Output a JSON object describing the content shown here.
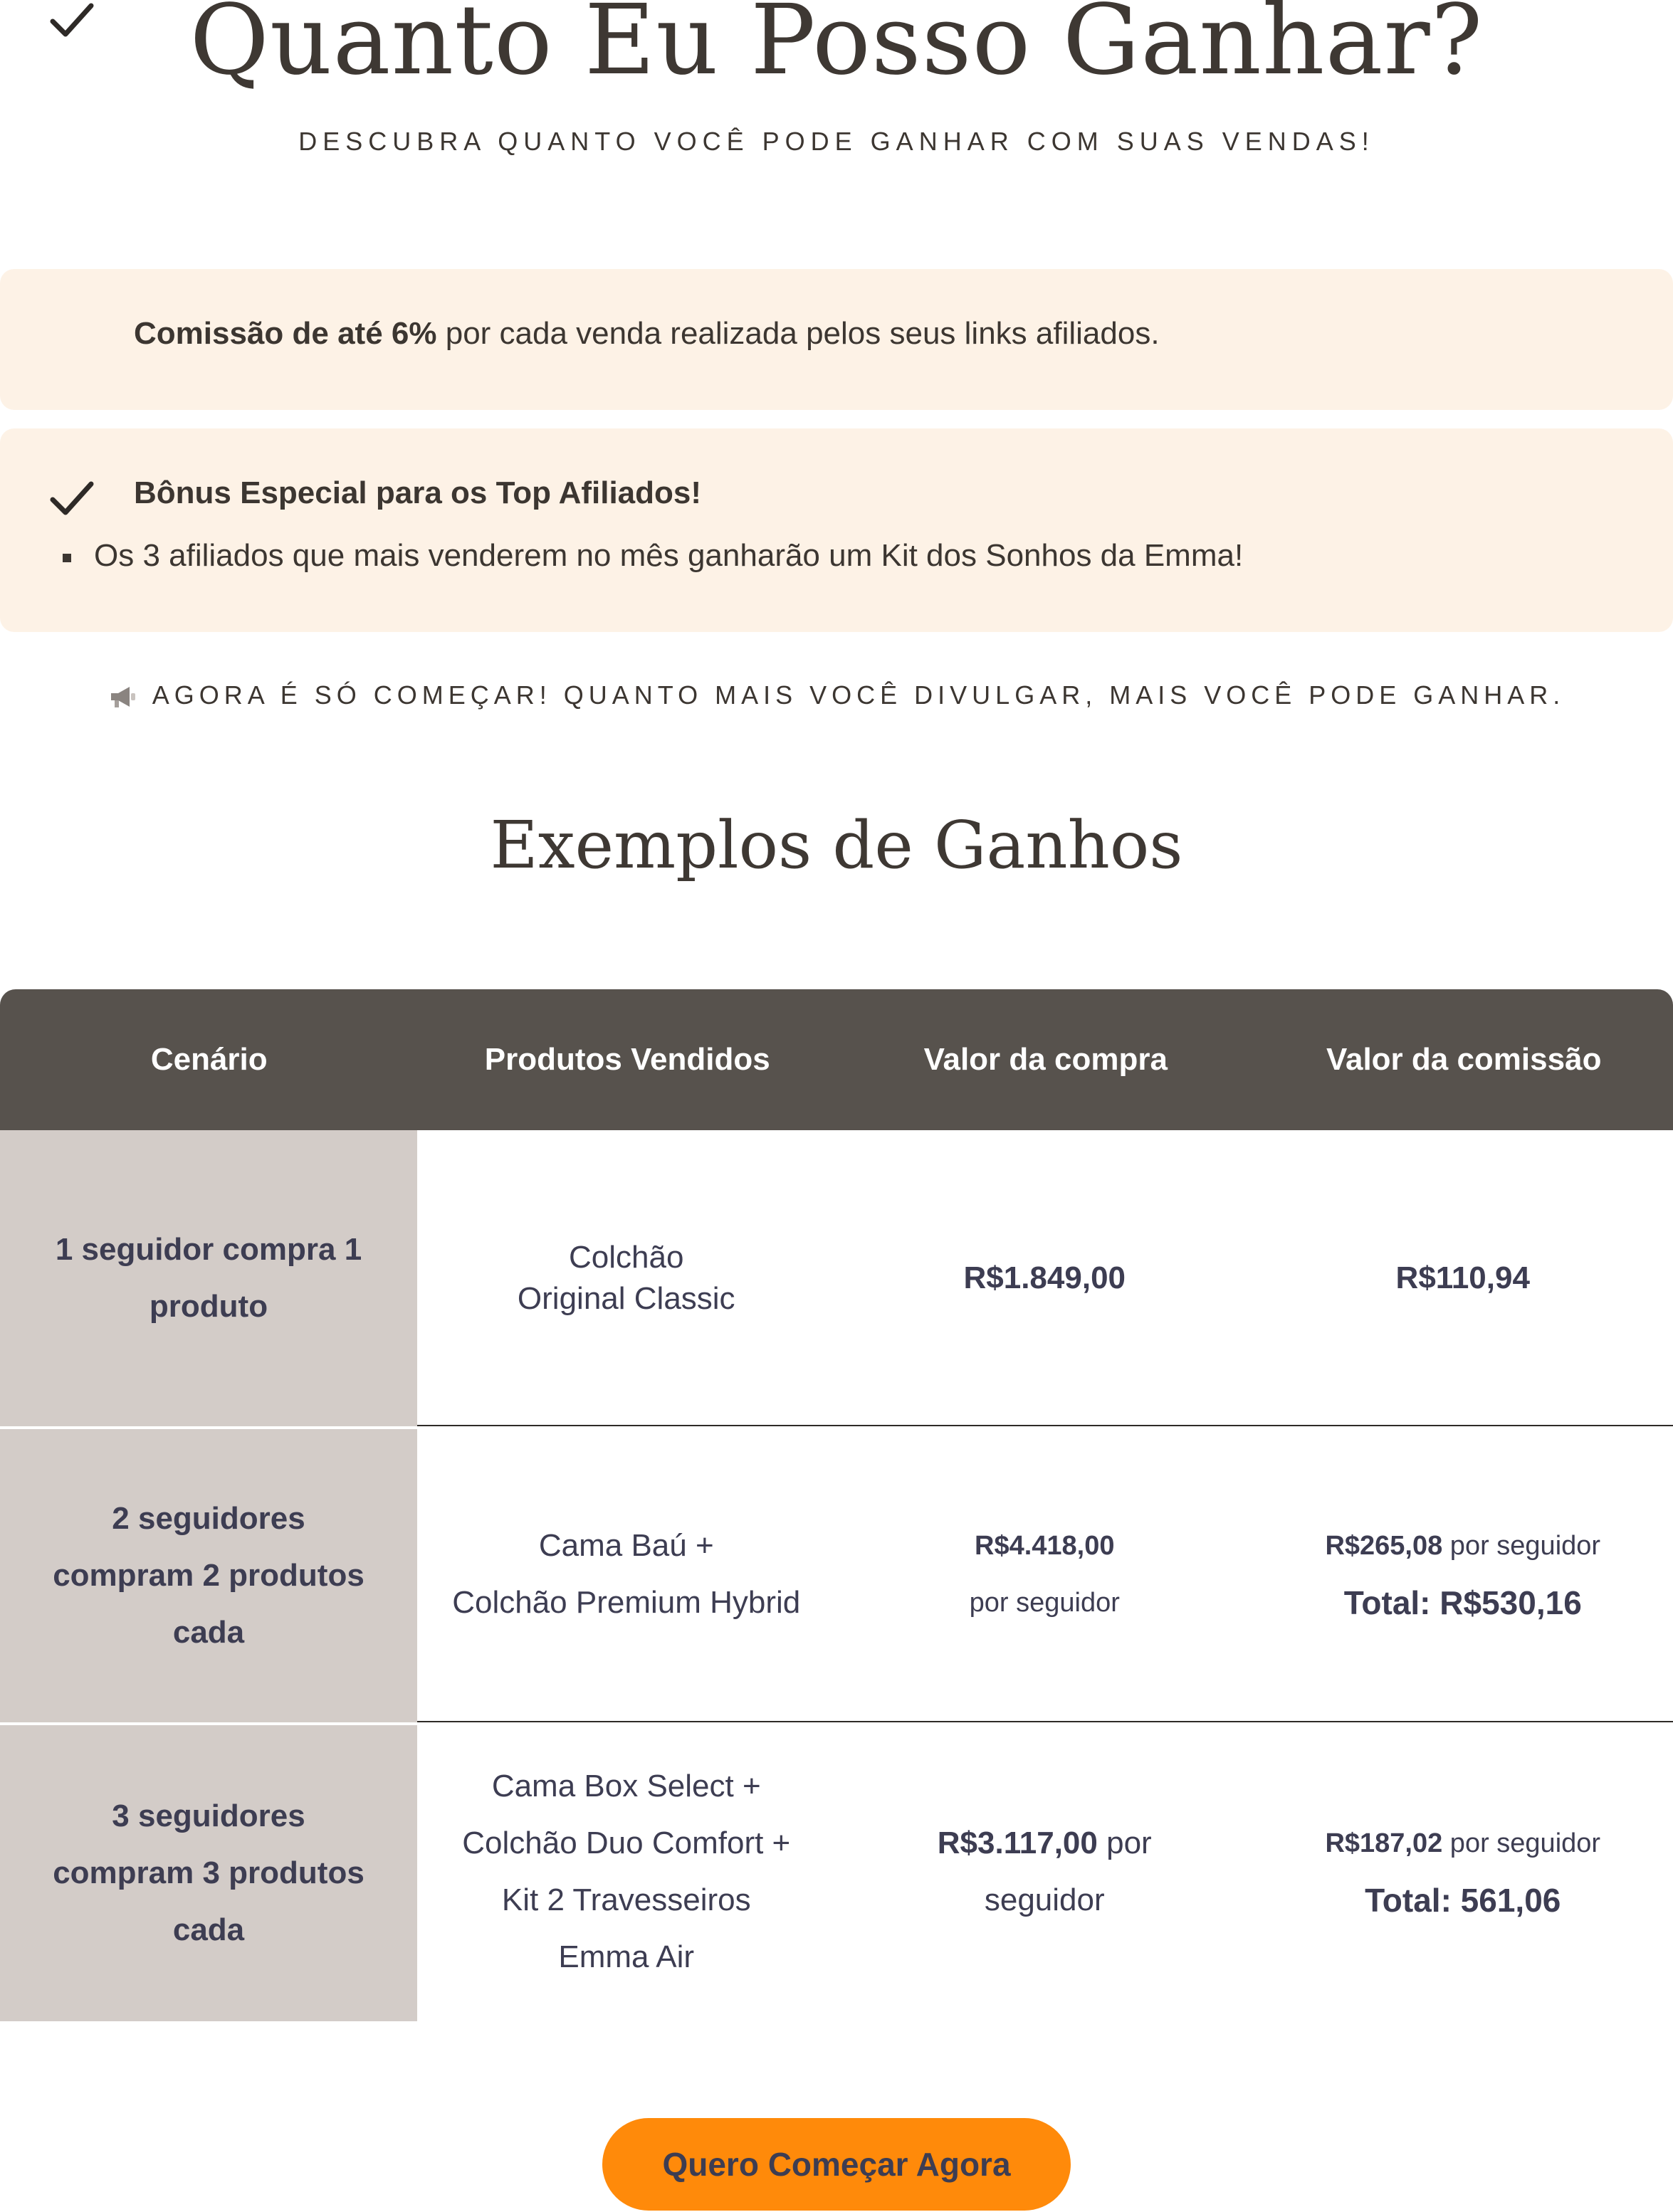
{
  "hero": {
    "title": "Quanto Eu Posso Ganhar?",
    "subtitle": "DESCUBRA QUANTO VOCÊ PODE GANHAR COM SUAS VENDAS!"
  },
  "benefits": {
    "commission_bold": "Comissão de até 6%",
    "commission_rest": " por cada venda realizada pelos seus links afiliados.",
    "bonus_title": "Bônus Especial para os Top Afiliados!",
    "bonus_item": "Os 3 afiliados que mais venderem no mês ganharão um Kit dos Sonhos da Emma!",
    "icon": "check-icon"
  },
  "cta_line": {
    "icon": "megaphone-icon",
    "text": "AGORA É SÓ COMEÇAR! QUANTO MAIS VOCÊ DIVULGAR, MAIS VOCÊ PODE GANHAR."
  },
  "examples": {
    "title": "Exemplos de Ganhos",
    "headers": [
      "Cenário",
      "Produtos Vendidos",
      "Valor da compra",
      "Valor da comissão"
    ],
    "rows": [
      {
        "scenario": [
          "1 seguidor compra 1",
          "produto"
        ],
        "products": [
          "Colchão",
          "Original Classic"
        ],
        "purchase_value": "R$1.849,00",
        "commission_value": "R$110,94"
      },
      {
        "scenario": [
          "2 seguidores",
          "compram 2 produtos",
          "cada"
        ],
        "products": [
          "Cama Baú +",
          "Colchão Premium Hybrid"
        ],
        "purchase_value": "R$4.418,00",
        "purchase_suffix": "por seguidor",
        "commission_value": "R$265,08",
        "commission_suffix": " por seguidor",
        "total": "Total: R$530,16"
      },
      {
        "scenario": [
          "3 seguidores",
          "compram 3 produtos",
          "cada"
        ],
        "products": [
          "Cama Box Select +",
          "Colchão Duo Comfort +",
          "Kit 2 Travesseiros",
          "Emma Air"
        ],
        "purchase_value": "R$3.117,00",
        "purchase_suffix_1": " por",
        "purchase_suffix_2": "seguidor",
        "commission_value": "R$187,02",
        "commission_suffix": " por seguidor",
        "total": "Total: 561,06"
      }
    ]
  },
  "button": {
    "label": "Quero Começar Agora",
    "color": "#ff8a0a"
  },
  "colors": {
    "card_bg": "#fdf2e6",
    "table_header": "#57524d",
    "scenario_bg": "#d3ccc8",
    "text_dark": "#3d3d52"
  }
}
